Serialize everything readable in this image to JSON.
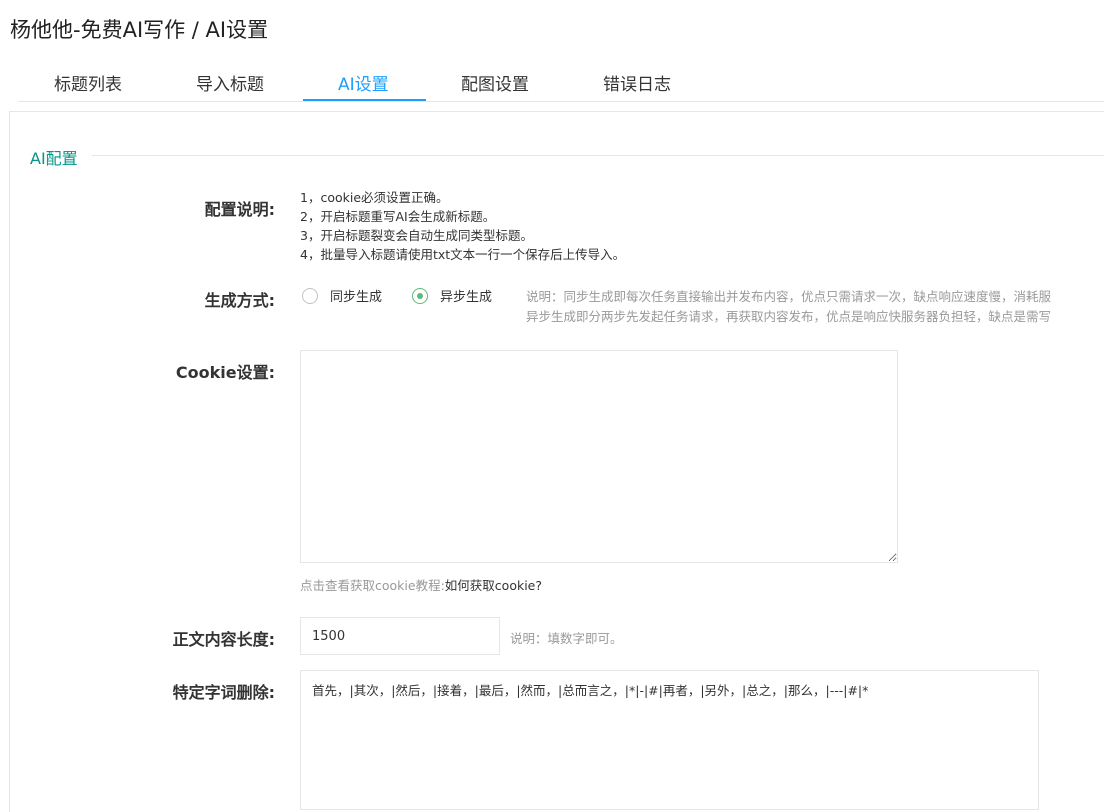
{
  "page": {
    "title": "杨他他-免费AI写作 / AI设置"
  },
  "tabs": [
    {
      "label": "标题列表"
    },
    {
      "label": "导入标题"
    },
    {
      "label": "AI设置"
    },
    {
      "label": "配图设置"
    },
    {
      "label": "错误日志"
    }
  ],
  "active_tab": "AI设置",
  "section": {
    "legend": "AI配置"
  },
  "config_desc": {
    "label": "配置说明:",
    "lines": [
      "1，cookie必须设置正确。",
      "2，开启标题重写AI会生成新标题。",
      "3，开启标题裂变会自动生成同类型标题。",
      "4，批量导入标题请使用txt文本一行一个保存后上传导入。"
    ]
  },
  "generation": {
    "label": "生成方式:",
    "options": [
      "同步生成",
      "异步生成"
    ],
    "selected": "异步生成",
    "note_lines": [
      "说明：同步生成即每次任务直接输出并发布内容，优点只需请求一次，缺点响应速度慢，消耗服",
      "异步生成即分两步先发起任务请求，再获取内容发布，优点是响应快服务器负担轻，缺点是需写"
    ]
  },
  "cookie": {
    "label": "Cookie设置:",
    "value": "",
    "help_hint": "点击查看获取cookie教程:",
    "help_link": "如何获取cookie?"
  },
  "content_length": {
    "label": "正文内容长度:",
    "value": "1500",
    "note": "说明：填数字即可。"
  },
  "word_removal": {
    "label": "特定字词删除:",
    "value": "首先，|其次，|然后，|接着，|最后，|然而，|总而言之，|*|-|#|再者，|另外，|总之，|那么，|---|#|*"
  },
  "colors": {
    "accent": "#1e9fff",
    "legend": "#009688",
    "radio_checked": "#5fb878"
  }
}
